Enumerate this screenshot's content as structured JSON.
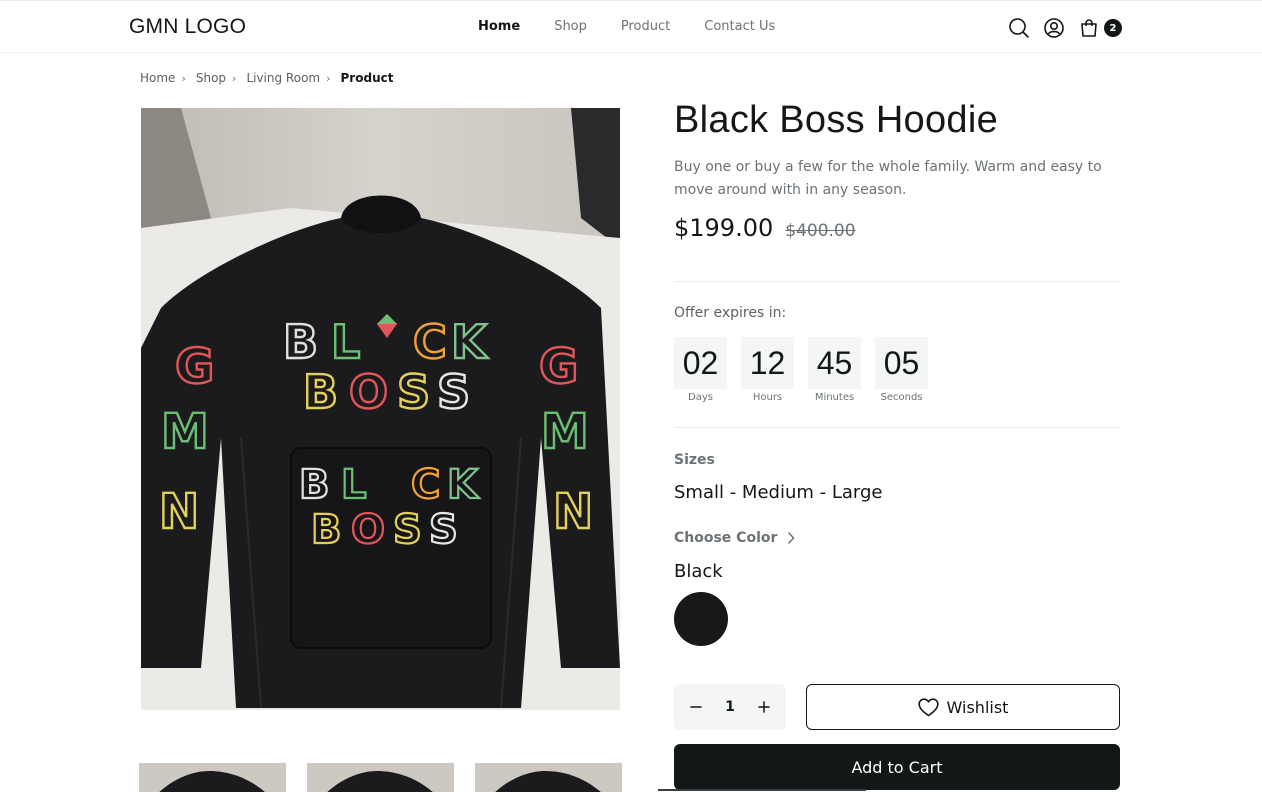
{
  "header": {
    "logo": "GMN LOGO",
    "nav": [
      "Home",
      "Shop",
      "Product",
      "Contact Us"
    ],
    "active_nav": "Home",
    "icons": [
      "search-icon",
      "user-icon",
      "cart-icon"
    ],
    "cart_count": "2"
  },
  "breadcrumb": [
    "Home",
    "Shop",
    "Living Room",
    "Product"
  ],
  "product": {
    "title": "Black Boss Hoodie",
    "description": "Buy one or buy a few for the whole family. Warm and easy to move around with in any season.",
    "price": "$199.00",
    "old_price": "$400.00",
    "offer_label": "Offer expires in:",
    "countdown": [
      {
        "value": "02",
        "label": "Days"
      },
      {
        "value": "12",
        "label": "Hours"
      },
      {
        "value": "45",
        "label": "Minutes"
      },
      {
        "value": "05",
        "label": "Seconds"
      }
    ],
    "sizes_label": "Sizes",
    "sizes_value": "Small - Medium - Large",
    "color_label": "Choose Color",
    "color_value": "Black",
    "swatch_color": "#161819",
    "quantity": "1",
    "wishlist_label": "Wishlist",
    "add_to_cart_label": "Add to Cart",
    "hoodie_print": {
      "chest_top": [
        "B",
        "L",
        "C",
        "K"
      ],
      "chest_bottom": [
        "B",
        "O",
        "S",
        "S"
      ],
      "sleeve": [
        "G",
        "M",
        "N"
      ]
    }
  },
  "colors": {
    "primary": "#141718",
    "muted": "#6c7275",
    "panel": "#f3f5f7",
    "divider": "#e8ecef"
  }
}
